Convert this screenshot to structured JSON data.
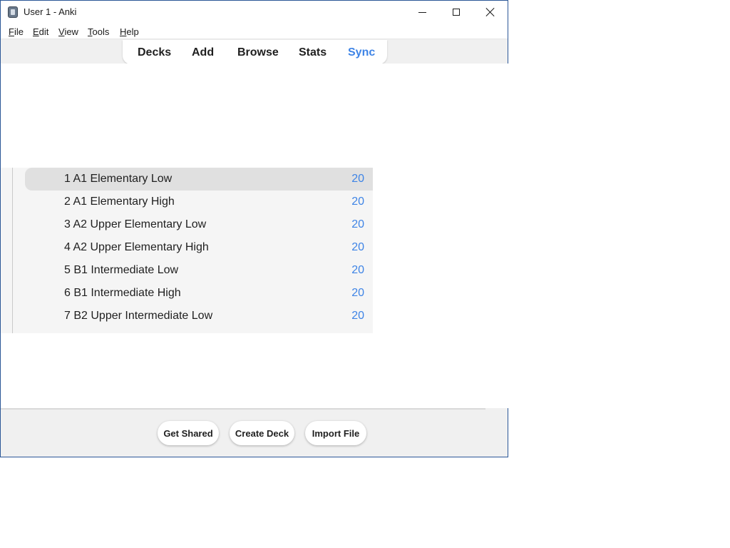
{
  "window": {
    "title": "User 1 - Anki"
  },
  "menu": [
    {
      "mnemonic": "F",
      "rest": "ile"
    },
    {
      "mnemonic": "E",
      "rest": "dit"
    },
    {
      "mnemonic": "V",
      "rest": "iew"
    },
    {
      "mnemonic": "T",
      "rest": "ools"
    },
    {
      "mnemonic": "H",
      "rest": "elp"
    }
  ],
  "toolbar": {
    "decks": "Decks",
    "add": "Add",
    "browse": "Browse",
    "stats": "Stats",
    "sync": "Sync",
    "sync_color": "#3e84e6"
  },
  "decks": [
    {
      "name": "1 A1 Elementary Low",
      "count": "20"
    },
    {
      "name": "2 A1 Elementary High",
      "count": "20"
    },
    {
      "name": "3 A2 Upper Elementary Low",
      "count": "20"
    },
    {
      "name": "4 A2 Upper Elementary High",
      "count": "20"
    },
    {
      "name": "5 B1 Intermediate Low",
      "count": "20"
    },
    {
      "name": "6 B1 Intermediate High",
      "count": "20"
    },
    {
      "name": "7 B2 Upper Intermediate Low",
      "count": "20"
    }
  ],
  "bottom": {
    "get_shared": "Get Shared",
    "create_deck": "Create Deck",
    "import_file": "Import File"
  },
  "colors": {
    "accent": "#3e84e6",
    "selected_row": "#e0e0e0"
  }
}
